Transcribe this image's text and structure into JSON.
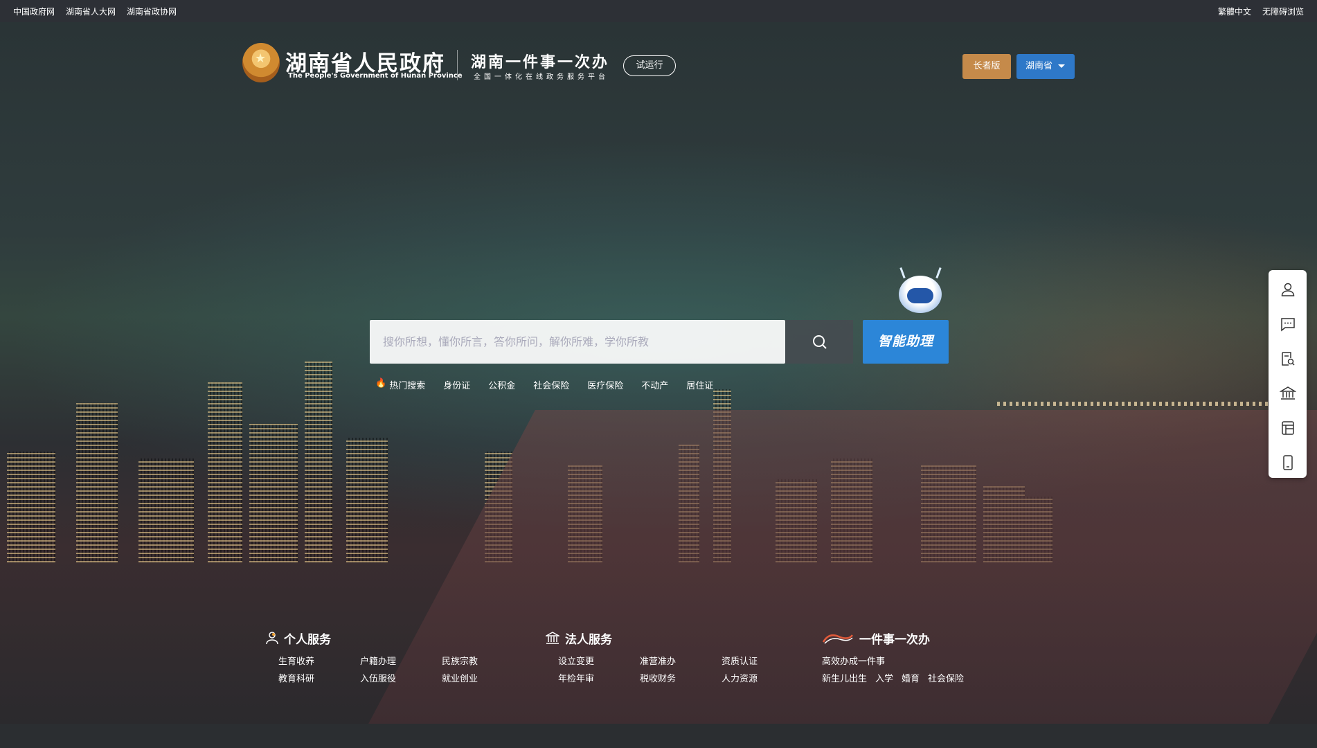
{
  "topbar": {
    "links": [
      "中国政府网",
      "湖南省人大网",
      "湖南省政协网"
    ],
    "traditional": "繁體中文",
    "accessible": "无障碍浏览"
  },
  "header": {
    "title_cn": "湖南省人民政府",
    "title_en": "The People's Government of Hunan Province",
    "slogan": "湖南一件事一次办",
    "slogan_sub": "全国一体化在线政务服务平台",
    "trial_label": "试运行",
    "elder_label": "长者版",
    "region_label": "湖南省"
  },
  "search": {
    "placeholder": "搜你所想，懂你所言，答你所问，解你所难，学你所教",
    "ai_label": "智能助理",
    "hot_label": "热门搜索",
    "hot_items": [
      "身份证",
      "公积金",
      "社会保险",
      "医疗保险",
      "不动产",
      "居住证"
    ]
  },
  "sidebar": {
    "icons": [
      "user-icon",
      "message-icon",
      "search-doc-icon",
      "bank-icon",
      "form-icon",
      "mobile-icon"
    ]
  },
  "services": {
    "personal": {
      "title": "个人服务",
      "items": [
        "生育收养",
        "户籍办理",
        "民族宗教",
        "教育科研",
        "入伍服役",
        "就业创业"
      ]
    },
    "legal": {
      "title": "法人服务",
      "items": [
        "设立变更",
        "准营准办",
        "资质认证",
        "年检年审",
        "税收财务",
        "人力资源"
      ]
    },
    "onething": {
      "title": "一件事一次办",
      "sub": "高效办成一件事",
      "items": [
        "新生儿出生",
        "入学",
        "婚育",
        "社会保险"
      ]
    }
  },
  "colors": {
    "topbar_bg": "#2d3036",
    "ai_button": "#2c86d8",
    "elder_button": "#c58a4a",
    "region_button": "#2e78c8"
  }
}
